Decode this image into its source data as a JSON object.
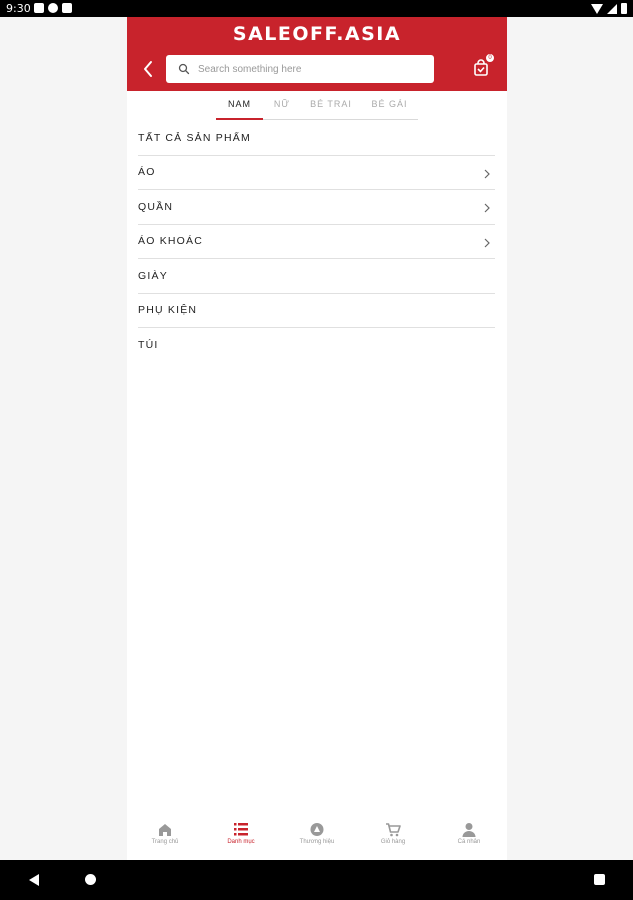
{
  "status_bar": {
    "time": "9:30"
  },
  "header": {
    "logo": "SALEOFF.ASIA",
    "search_placeholder": "Search something here",
    "cart_badge": "0"
  },
  "tabs": [
    {
      "label": "NAM",
      "active": true
    },
    {
      "label": "NỮ",
      "active": false
    },
    {
      "label": "BÉ TRAI",
      "active": false
    },
    {
      "label": "BÉ GÁI",
      "active": false
    }
  ],
  "categories": [
    {
      "label": "TẤT CẢ SẢN PHẨM",
      "has_children": false
    },
    {
      "label": "ÁO",
      "has_children": true
    },
    {
      "label": "QUẦN",
      "has_children": true
    },
    {
      "label": "ÁO KHOÁC",
      "has_children": true
    },
    {
      "label": "GIÀY",
      "has_children": false
    },
    {
      "label": "PHỤ KIỆN",
      "has_children": false
    },
    {
      "label": "TÚI",
      "has_children": false
    }
  ],
  "bottom_nav": [
    {
      "label": "Trang chủ",
      "icon": "home-icon",
      "active": false
    },
    {
      "label": "Danh mục",
      "icon": "list-icon",
      "active": true
    },
    {
      "label": "Thương hiệu",
      "icon": "brand-icon",
      "active": false
    },
    {
      "label": "Giỏ hàng",
      "icon": "cart-icon",
      "active": false
    },
    {
      "label": "Cá nhân",
      "icon": "user-icon",
      "active": false
    }
  ],
  "colors": {
    "brand_red": "#c8232c",
    "inactive_gray": "#aaaaaa"
  }
}
